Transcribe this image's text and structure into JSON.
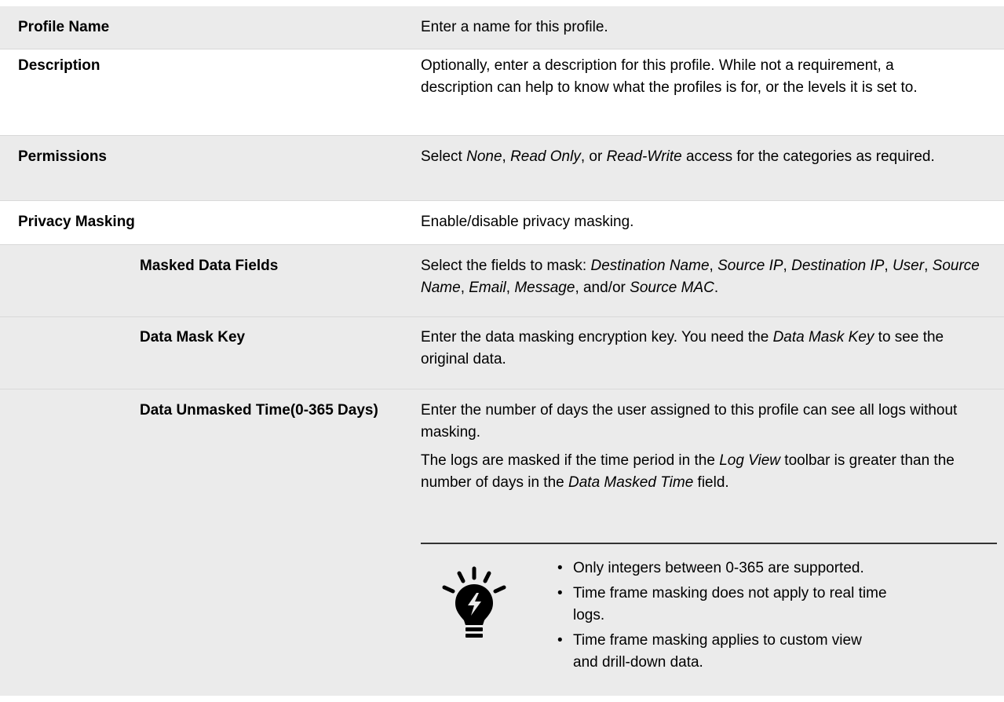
{
  "rows": [
    {
      "label": "Profile Name",
      "description": "Enter a name for this profile."
    },
    {
      "label": "Description",
      "description": "Optionally, enter a description for this profile. While not a requirement, a description can help to know what the profiles is for, or the levels it is set to."
    },
    {
      "label": "Permissions",
      "parts": [
        "Select ",
        "None",
        ", ",
        "Read Only",
        ", or ",
        "Read-Write",
        " access for the categories as required."
      ]
    },
    {
      "label": "Privacy Masking",
      "description": "Enable/disable privacy masking."
    },
    {
      "label": "Masked Data Fields",
      "parts": [
        "Select the fields to mask: ",
        "Destination Name",
        ", ",
        "Source IP",
        ", ",
        "Destination IP",
        ", ",
        "User",
        ", ",
        "Source Name",
        ", ",
        "Email",
        ", ",
        "Message",
        ", and/or ",
        "Source MAC",
        "."
      ]
    },
    {
      "label": "Data Mask Key",
      "parts": [
        "Enter the data masking encryption key. You need the ",
        "Data Mask Key",
        " to see the original data."
      ]
    },
    {
      "label": "Data Unmasked Time(0-365 Days)",
      "description": "Enter the number of days the user assigned to this profile can see all logs without masking.",
      "parts2": [
        "The logs are masked if the time period in the ",
        "Log View",
        " toolbar is greater than the number of days in the ",
        "Data Masked Time",
        " field."
      ]
    }
  ],
  "note": {
    "icon": "lightbulb-tip-icon",
    "items": [
      "Only integers between 0-365 are supported.",
      "Time frame masking does not apply to real time logs.",
      "Time frame masking applies to custom view and drill-down data."
    ]
  }
}
